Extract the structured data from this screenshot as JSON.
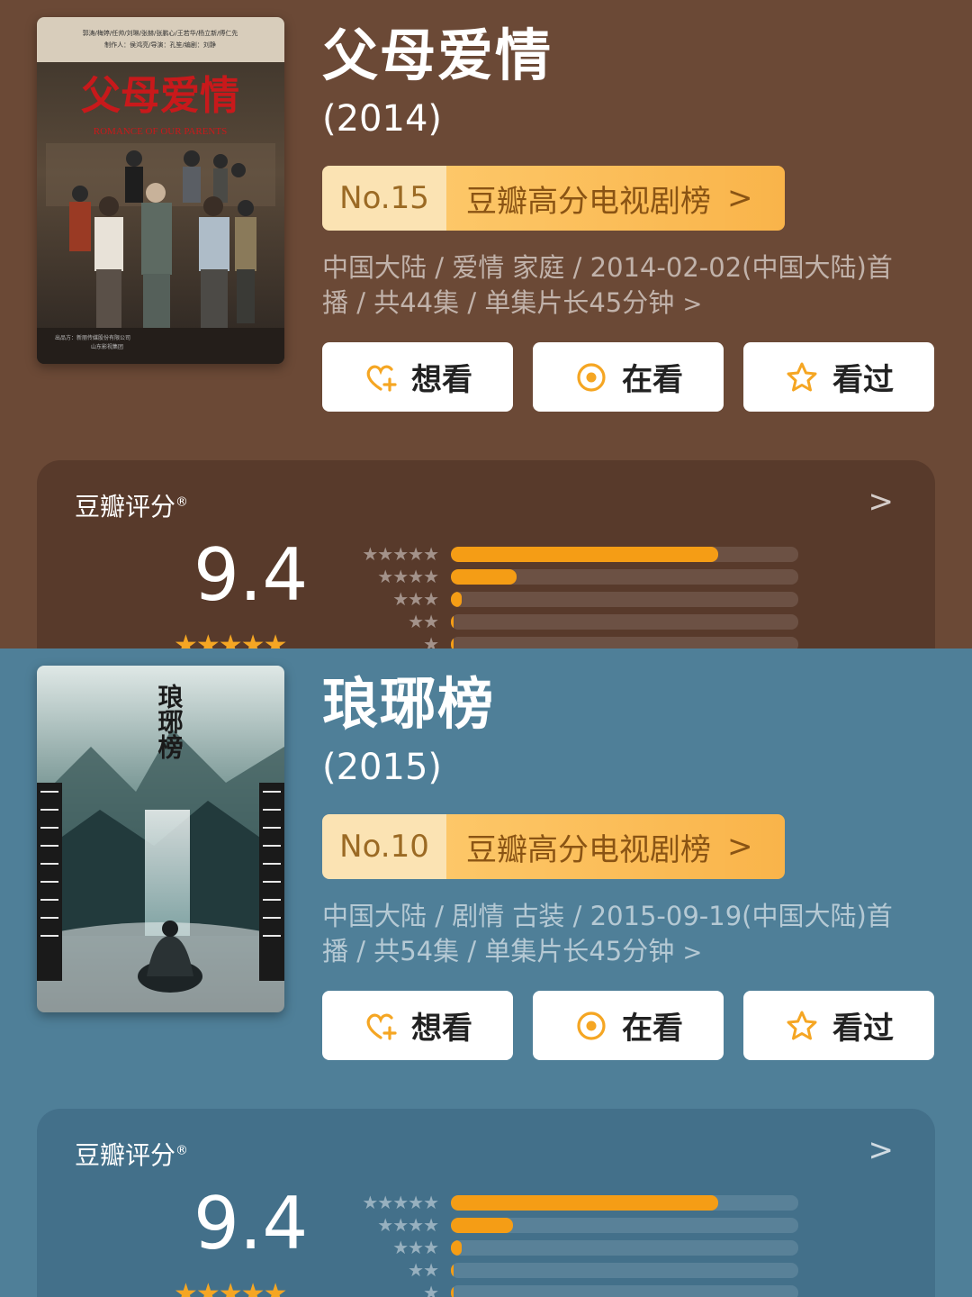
{
  "shows": [
    {
      "title": "父母爱情",
      "year": "(2014)",
      "rank_no": "No.15",
      "rank_list": "豆瓣高分电视剧榜",
      "meta_line1": "中国大陆 / 爱情 家庭 / 2014-02-02(中国大陆)首",
      "meta_line2": "播 / 共44集 / 单集片长45分钟",
      "buttons": {
        "want": "想看",
        "watching": "在看",
        "watched": "看过"
      },
      "rating_label": "豆瓣评分",
      "score": "9.4",
      "distribution": [
        0.77,
        0.19,
        0.03,
        0.005,
        0.003
      ],
      "poster": {
        "credits_line1": "郭涛/梅婷/任帅/刘琳/张赫/张鹏心/王若华/杨立新/傅仁先",
        "credits_line2": "制作人：侯鸿亮/导演：孔笙/编剧：刘静",
        "title_cn": "父母爱情",
        "title_en": "ROMANCE OF OUR PARENTS",
        "footer_line1": "出品方：新丽传媒股份有限公司",
        "footer_line2": "山东影视集团"
      }
    },
    {
      "title": "琅琊榜",
      "year": "(2015)",
      "rank_no": "No.10",
      "rank_list": "豆瓣高分电视剧榜",
      "meta_line1": "中国大陆 / 剧情 古装 / 2015-09-19(中国大陆)首",
      "meta_line2": "播 / 共54集 / 单集片长45分钟",
      "buttons": {
        "want": "想看",
        "watching": "在看",
        "watched": "看过"
      },
      "rating_label": "豆瓣评分",
      "score": "9.4",
      "distribution": [
        0.77,
        0.18,
        0.03,
        0.005,
        0.003
      ],
      "poster": {
        "title_calligraphy": "琅琊榜"
      }
    }
  ],
  "colors": {
    "accent": "#f59d15",
    "panel_a": "#6b4936",
    "panel_b": "#4f7f98"
  }
}
